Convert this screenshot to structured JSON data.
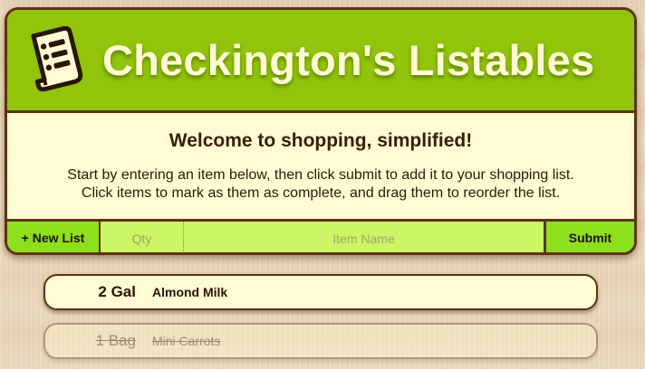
{
  "app": {
    "title": "Checkington's Listables",
    "logo_icon": "receipt-list-icon"
  },
  "welcome": {
    "heading": "Welcome to shopping, simplified!",
    "line1": "Start by entering an item below, then click submit to add it to your shopping list.",
    "line2": "Click items to mark as them as complete, and drag them to reorder the list."
  },
  "input_bar": {
    "new_list_label": "+ New List",
    "qty_value": "",
    "qty_placeholder": "Qty",
    "item_value": "",
    "item_placeholder": "Item Name",
    "submit_label": "Submit"
  },
  "list": {
    "items": [
      {
        "qty": "2 Gal",
        "name": "Almond Milk",
        "complete": false
      },
      {
        "qty": "1 Bag",
        "name": "Mini Carrots",
        "complete": true
      }
    ]
  },
  "colors": {
    "header_green": "#91c40a",
    "button_green": "#8ce01c",
    "input_green": "#ccf564",
    "cream": "#fffbd2",
    "brown_border": "#5a3410"
  }
}
